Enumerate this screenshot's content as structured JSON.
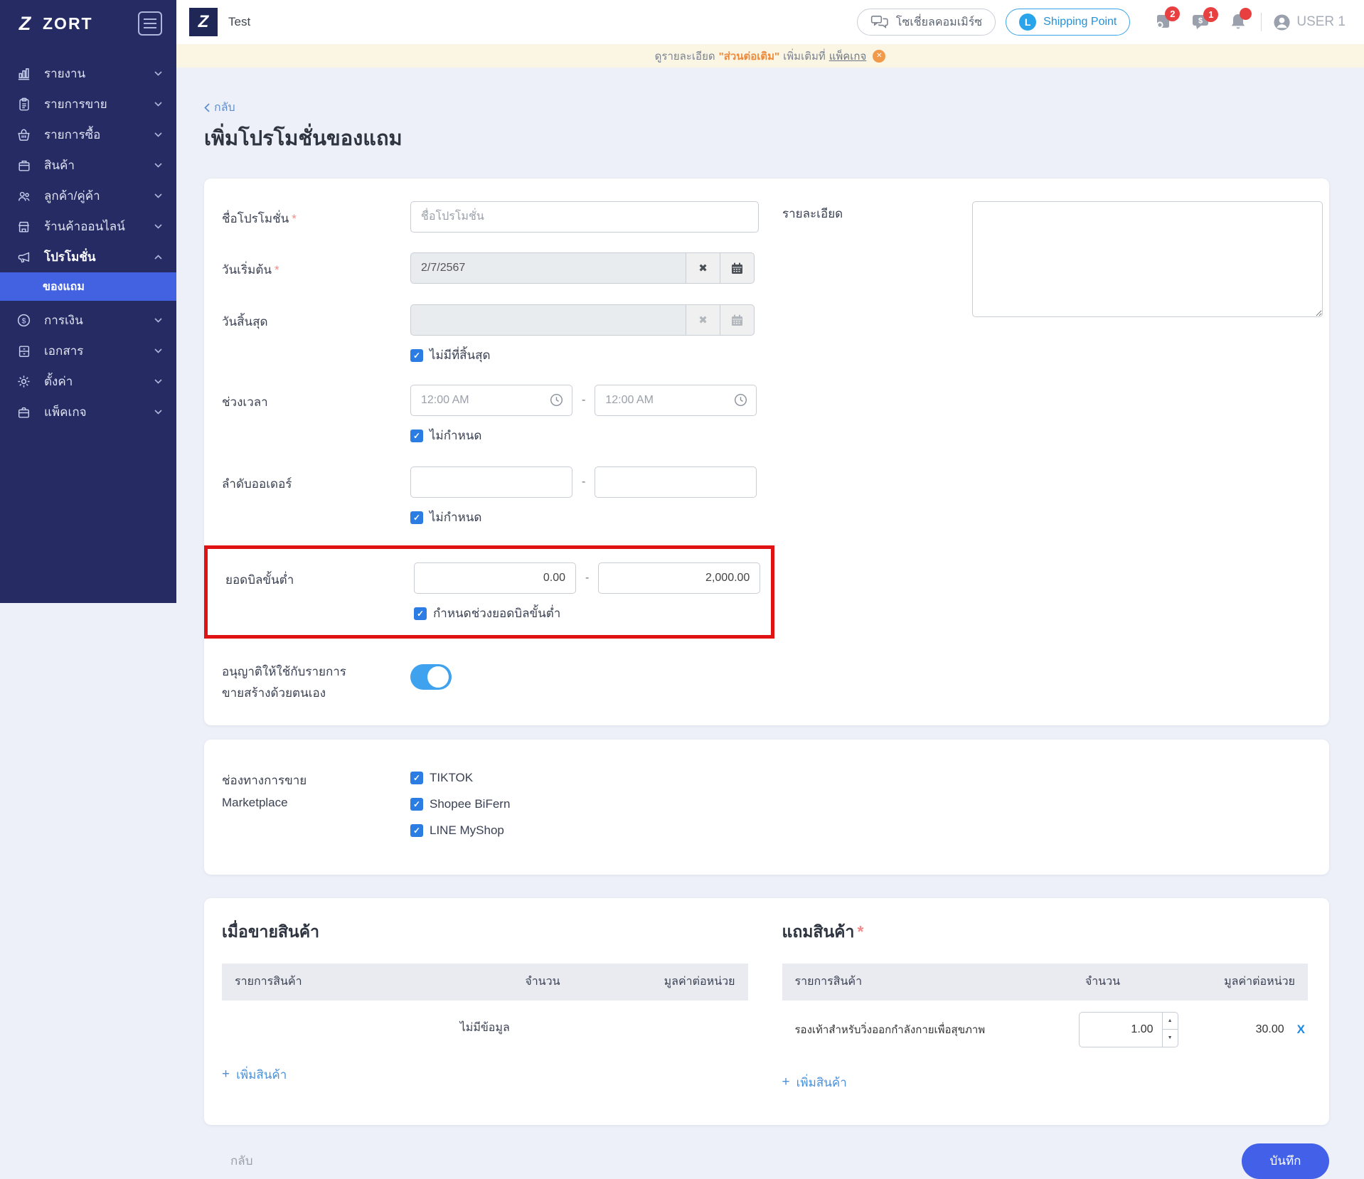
{
  "colors": {
    "sidebar_navy": "#262c63",
    "accent_blue": "#4262e2",
    "save_blue": "#4361e8",
    "toggle_blue": "#3fa2ee",
    "highlight_red": "#df1313",
    "badge_red": "#e84040",
    "banner_orange": "#ee8a3c",
    "shipping_blue": "#2392d8"
  },
  "sidebar": {
    "logo": "ZORT",
    "items": [
      {
        "label": "รายงาน"
      },
      {
        "label": "รายการขาย"
      },
      {
        "label": "รายการซื้อ"
      },
      {
        "label": "สินค้า"
      },
      {
        "label": "ลูกค้า/คู่ค้า"
      },
      {
        "label": "ร้านค้าออนไลน์"
      },
      {
        "label": "โปรโมชั่น"
      },
      {
        "label": "การเงิน"
      },
      {
        "label": "เอกสาร"
      },
      {
        "label": "ตั้งค่า"
      },
      {
        "label": "แพ็คเกจ"
      }
    ],
    "active_submenu": "ของแถม"
  },
  "topbar": {
    "workspace_name": "Test",
    "social_commerce": "โซเชี่ยลคอมเมิร์ซ",
    "shipping_point": "Shipping Point",
    "promo_badge": "2",
    "message_badge": "1",
    "username": "USER 1"
  },
  "banner": {
    "prefix": "ดูรายละเอียด",
    "highlight": "\"ส่วนต่อเติม\"",
    "middle": "เพิ่มเติมที่",
    "link": "แพ็คเกจ"
  },
  "page": {
    "back": "กลับ",
    "title": "เพิ่มโปรโมชั่นของแถม",
    "required_marker": "*"
  },
  "form": {
    "name_label": "ชื่อโปรโมชั่น",
    "name_placeholder": "ชื่อโปรโมชั่น",
    "start_date_label": "วันเริ่มต้น",
    "start_date_value": "2/7/2567",
    "end_date_label": "วันสิ้นสุด",
    "no_end_label": "ไม่มีที่สิ้นสุด",
    "time_range_label": "ช่วงเวลา",
    "time_placeholder": "12:00 AM",
    "unset_label": "ไม่กำหนด",
    "order_range_label": "ลำดับออเดอร์",
    "min_bill_label": "ยอดบิลขั้นต่ำ",
    "min_bill_from": "0.00",
    "min_bill_to": "2,000.00",
    "min_bill_check_label": "กำหนดช่วงยอดบิลขั้นต่ำ",
    "allow_manual_line1": "อนุญาติให้ใช้กับรายการ",
    "allow_manual_line2": "ขายสร้างด้วยตนเอง",
    "description_label": "รายละเอียด",
    "range_dash": "-"
  },
  "channels": {
    "label_line1": "ช่องทางการขาย",
    "label_line2": "Marketplace",
    "options": [
      {
        "label": "TIKTOK"
      },
      {
        "label": "Shopee BiFern"
      },
      {
        "label": "LINE MyShop"
      }
    ]
  },
  "sell_table": {
    "title": "เมื่อขายสินค้า",
    "col_product": "รายการสินค้า",
    "col_qty": "จำนวน",
    "col_value": "มูลค่าต่อหน่วย",
    "empty_text": "ไม่มีข้อมูล",
    "add_label": "เพิ่มสินค้า"
  },
  "free_table": {
    "title": "แถมสินค้า",
    "col_product": "รายการสินค้า",
    "col_qty": "จำนวน",
    "col_value": "มูลค่าต่อหน่วย",
    "row": {
      "product": "รองเท้าสำหรับวิ่งออกกำลังกายเพื่อสุขภาพ",
      "qty": "1.00",
      "unit_value": "30.00",
      "remove": "X"
    },
    "add_label": "เพิ่มสินค้า"
  },
  "footer": {
    "back": "กลับ",
    "save": "บันทึก"
  }
}
